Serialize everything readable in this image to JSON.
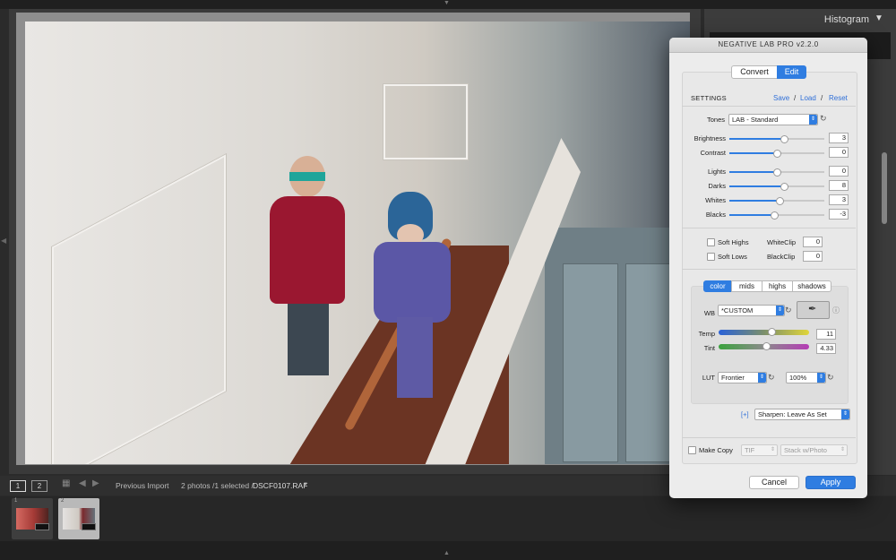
{
  "histogram": {
    "title": "Histogram"
  },
  "filmstrip": {
    "view1": "1",
    "view2": "2",
    "source": "Previous Import",
    "info": "2 photos /1 selected /",
    "filename": "DSCF0107.RAF",
    "thumbs": [
      {
        "index": "1"
      },
      {
        "index": "2"
      }
    ]
  },
  "dialog": {
    "title": "NEGATIVE LAB PRO v2.2.0",
    "tabs": {
      "convert": "Convert",
      "edit": "Edit"
    },
    "settings": {
      "label": "SETTINGS",
      "save": "Save",
      "load": "Load",
      "reset": "Reset",
      "sep": "/"
    },
    "tones": {
      "label": "Tones",
      "value": "LAB - Standard"
    },
    "sliders": {
      "brightness": {
        "label": "Brightness",
        "value": "3",
        "position": 0.58
      },
      "contrast": {
        "label": "Contrast",
        "value": "0",
        "position": 0.5
      },
      "lights": {
        "label": "Lights",
        "value": "0",
        "position": 0.5
      },
      "darks": {
        "label": "Darks",
        "value": "8",
        "position": 0.58
      },
      "whites": {
        "label": "Whites",
        "value": "3",
        "position": 0.53
      },
      "blacks": {
        "label": "Blacks",
        "value": "-3",
        "position": 0.47
      }
    },
    "clip": {
      "soft_highs": "Soft Highs",
      "soft_lows": "Soft Lows",
      "whiteclip_label": "WhiteClip",
      "whiteclip_value": "0",
      "blackclip_label": "BlackClip",
      "blackclip_value": "0"
    },
    "color_tabs": {
      "color": "color",
      "mids": "mids",
      "highs": "highs",
      "shadows": "shadows"
    },
    "wb": {
      "label": "WB",
      "value": "*CUSTOM"
    },
    "temp": {
      "label": "Temp",
      "value": "11",
      "position": 0.58
    },
    "tint": {
      "label": "Tint",
      "value": "4.33",
      "position": 0.52
    },
    "lut": {
      "label": "LUT",
      "value": "Frontier",
      "amount": "100%"
    },
    "sharpen": {
      "plus": "[+]",
      "value": "Sharpen: Leave As Set"
    },
    "makecopy": {
      "label": "Make Copy",
      "format": "TIF",
      "stack": "Stack w/Photo"
    },
    "buttons": {
      "cancel": "Cancel",
      "apply": "Apply"
    },
    "colors": {
      "accent": "#2f7de1",
      "link": "#2f6fd8"
    }
  }
}
